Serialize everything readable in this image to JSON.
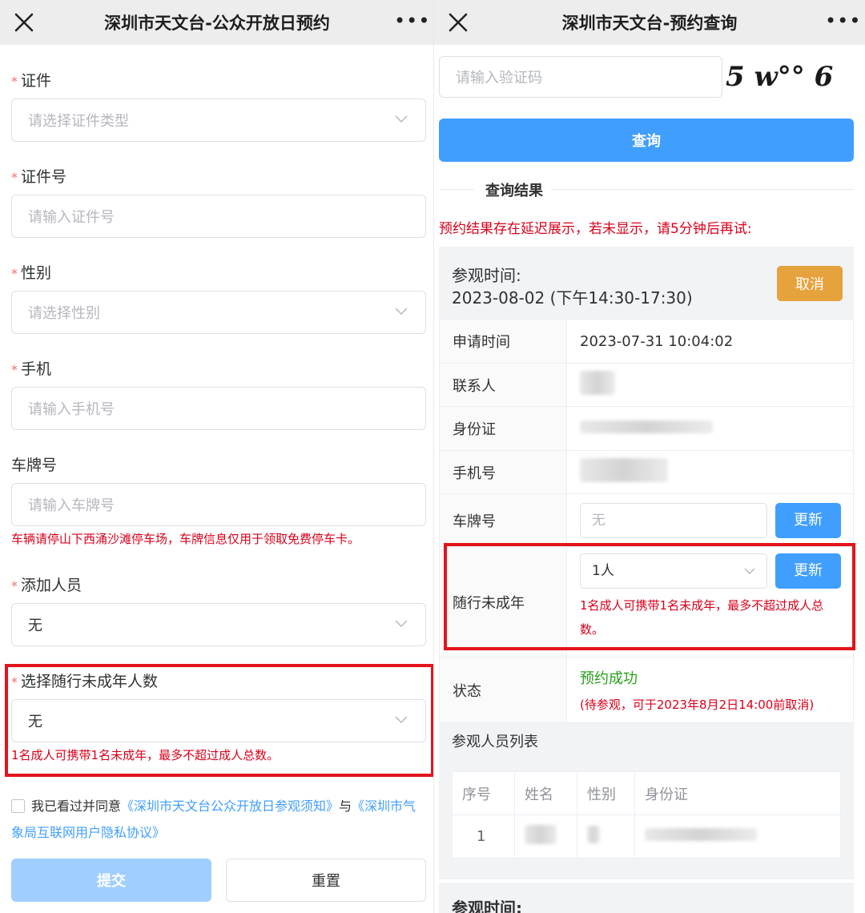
{
  "left": {
    "title": "深圳市天文台-公众开放日预约",
    "more": "•••",
    "fields": {
      "id_type": {
        "label": "证件",
        "placeholder": "请选择证件类型"
      },
      "id_number": {
        "label": "证件号",
        "placeholder": "请输入证件号"
      },
      "gender": {
        "label": "性别",
        "placeholder": "请选择性别"
      },
      "phone": {
        "label": "手机",
        "placeholder": "请输入手机号"
      },
      "plate": {
        "label": "车牌号",
        "placeholder": "请输入车牌号",
        "hint": "车辆请停山下西涌沙滩停车场，车牌信息仅用于领取免费停车卡。"
      },
      "add_person": {
        "label": "添加人员",
        "value": "无"
      },
      "minors": {
        "label": "选择随行未成年人数",
        "value": "无",
        "hint": "1名成人可携带1名未成年，最多不超过成人总数。"
      }
    },
    "agree": {
      "text1": "我已看过并同意",
      "link1": "《深圳市天文台公众开放日参观须知》",
      "text2": "与",
      "link2": "《深圳市气象局互联网用户隐私协议》"
    },
    "submit": "提交",
    "reset": "重置"
  },
  "right": {
    "title": "深圳市天文台-预约查询",
    "more": "•••",
    "captcha": {
      "placeholder": "请输入验证码",
      "code": "5 w°° 6"
    },
    "query_button": "查询",
    "section_title": "查询结果",
    "notice": "预约结果存在延迟展示，若未显示，请5分钟后再试:",
    "visit_time_label": "参观时间:",
    "visit_time_value": "2023-08-02 (下午14:30-17:30)",
    "cancel": "取消",
    "rows": {
      "apply_time": {
        "key": "申请时间",
        "value": "2023-07-31 10:04:02"
      },
      "contact": {
        "key": "联系人"
      },
      "id_card": {
        "key": "身份证"
      },
      "phone": {
        "key": "手机号"
      },
      "plate": {
        "key": "车牌号",
        "value": "无",
        "button": "更新"
      },
      "minors": {
        "key": "随行未成年",
        "value": "1人",
        "button": "更新",
        "hint": "1名成人可携带1名未成年，最多不超过成人总数。"
      },
      "status": {
        "key": "状态",
        "value": "预约成功",
        "sub": "(待参观，可于2023年8月2日14:00前取消)"
      }
    },
    "people_list": {
      "title": "参观人员列表",
      "headers": [
        "序号",
        "姓名",
        "性别",
        "身份证"
      ],
      "rows": [
        {
          "index": "1"
        }
      ]
    },
    "visit_time_label_2": "参观时间:"
  }
}
